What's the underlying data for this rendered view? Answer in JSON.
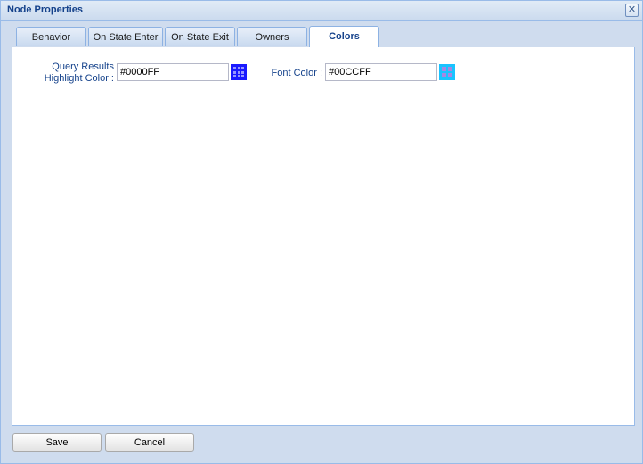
{
  "window": {
    "title": "Node Properties",
    "close_label": "✕"
  },
  "tabs": [
    {
      "label": "Behavior",
      "active": false
    },
    {
      "label": "On State Enter",
      "active": false
    },
    {
      "label": "On State Exit",
      "active": false
    },
    {
      "label": "Owners",
      "active": false
    },
    {
      "label": "Colors",
      "active": true
    }
  ],
  "colors": {
    "highlight": {
      "label_line1": "Query Results",
      "label_line2": "Highlight Color :",
      "value": "#0000FF",
      "swatch_color": "#1a1aff"
    },
    "font": {
      "label": "Font Color :",
      "value": "#00CCFF",
      "swatch_color": "#19c3ff"
    }
  },
  "footer": {
    "save_label": "Save",
    "cancel_label": "Cancel"
  }
}
